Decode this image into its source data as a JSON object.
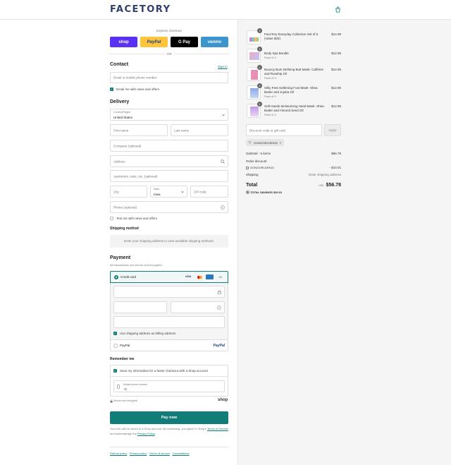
{
  "header": {
    "logo": "FACETORY",
    "cart_icon": "shopping-bag-icon"
  },
  "express": {
    "label": "Express checkout",
    "buttons": [
      {
        "label": "shop",
        "color": "#5a31f4"
      },
      {
        "label": "PayPal",
        "color": "#ffc439"
      },
      {
        "label": "G Pay",
        "color": "#000000"
      },
      {
        "label": "venmo",
        "color": "#3d95ce"
      }
    ],
    "or": "OR"
  },
  "contact": {
    "title": "Contact",
    "sign_in": "Sign in",
    "email_placeholder": "Email or mobile phone number",
    "news_label": "Email me with news and offers"
  },
  "delivery": {
    "title": "Delivery",
    "country_label": "Country/Region",
    "country_value": "United States",
    "first_name": "First name",
    "last_name": "Last name",
    "company": "Company (optional)",
    "address": "Address",
    "apartment": "Apartment, suite, etc. (optional)",
    "city": "City",
    "state_label": "State",
    "state_value": "Iowa",
    "zip": "ZIP code",
    "phone": "Phone (optional)",
    "text_news": "Text me with news and offers"
  },
  "shipping": {
    "title": "Shipping method",
    "placeholder": "Enter your shipping address to view available shipping methods."
  },
  "payment": {
    "title": "Payment",
    "subtitle": "All transactions are secure and encrypted.",
    "credit_card": "Credit card",
    "cards": [
      "VISA",
      "MC",
      "AMEX"
    ],
    "more_cards": "+5",
    "billing_same": "Use shipping address as billing address",
    "paypal": "PayPal",
    "paypal_logo": "PayPal"
  },
  "remember": {
    "title": "Remember me",
    "save_label": "Save my information for a faster checkout with a Shop account",
    "phone_label": "Mobile phone number",
    "phone_prefix": "+1",
    "secure": "Secure and encrypted",
    "shop": "shop"
  },
  "pay_button": "Pay now",
  "legal": {
    "pre": "Your info will be saved to a Shop account. By continuing, you agree to Shop's",
    "terms": "Terms of Service",
    "mid": "and acknowledge the",
    "privacy": "Privacy Policy",
    "end": "."
  },
  "footer_links": [
    "Refund policy",
    "Privacy policy",
    "Terms of service",
    "Cancellations"
  ],
  "cart": {
    "items": [
      {
        "qty": "1",
        "name": "FaceTory Everyday Collection Set of 6 (Value $20)",
        "sub": "",
        "price": "$14.99"
      },
      {
        "qty": "1",
        "name": "Body Spa Bundle",
        "sub": "Pack of 3",
        "price": "$12.95"
      },
      {
        "qty": "1",
        "name": "Bouncy Bum Defining Butt Mask- Caffeine and Rosehip Oil",
        "sub": "Pack of 3",
        "price": "$12.95"
      },
      {
        "qty": "1",
        "name": "Silky Feet Softening Foot Mask- Shea Butter and Jojoba Oil",
        "sub": "Pack of 3",
        "price": "$12.95"
      },
      {
        "qty": "1",
        "name": "Soft Hands Moisturizing Hand Mask- Shea Butter and Almond Seed Oil",
        "sub": "Pack of 3",
        "price": "$12.95"
      }
    ],
    "discount_placeholder": "Discount code or gift card",
    "apply": "Apply",
    "code": "GONZGIRLDEN15",
    "subtotal_label": "Subtotal · 5 items",
    "subtotal": "$66.79",
    "order_discount": "Order discount",
    "discount_code": "GONZGIRLDEN15",
    "discount_value": "- $10.01",
    "shipping_label": "Shipping",
    "shipping_value": "Enter shipping address",
    "total_label": "Total",
    "currency": "USD",
    "total": "$56.78",
    "savings_label": "TOTAL SAVINGS",
    "savings": "$10.01"
  }
}
